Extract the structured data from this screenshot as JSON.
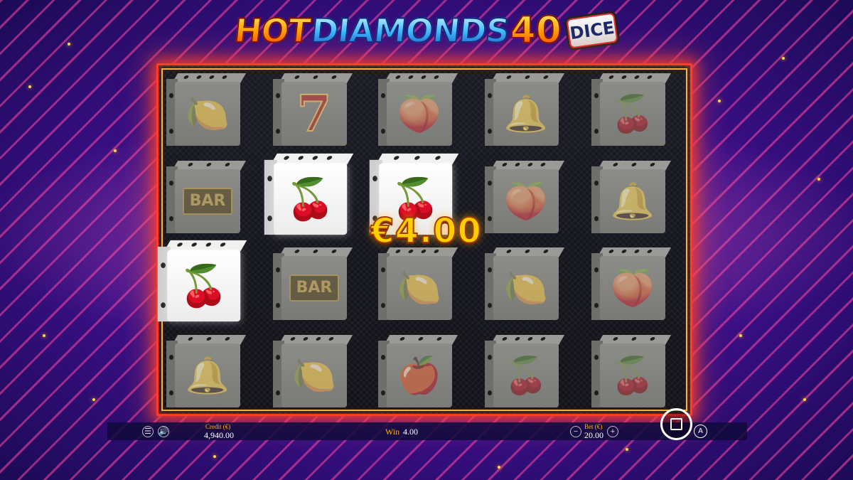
{
  "logo": {
    "hot": "HOT",
    "diamonds": "DIAMONDS",
    "number": "40",
    "badge": "DICE"
  },
  "win_overlay": "€4.00",
  "reels": [
    [
      {
        "symbol": "lemon",
        "glyph": "🍋",
        "lit": false
      },
      {
        "symbol": "bar",
        "glyph": "BAR",
        "lit": false
      },
      {
        "symbol": "cherry",
        "glyph": "🍒",
        "lit": true
      },
      {
        "symbol": "bell",
        "glyph": "🔔",
        "lit": false
      }
    ],
    [
      {
        "symbol": "seven",
        "glyph": "7",
        "lit": false
      },
      {
        "symbol": "cherry",
        "glyph": "🍒",
        "lit": true
      },
      {
        "symbol": "bar",
        "glyph": "BAR",
        "lit": false
      },
      {
        "symbol": "lemon",
        "glyph": "🍋",
        "lit": false
      }
    ],
    [
      {
        "symbol": "plum",
        "glyph": "🍑",
        "lit": false
      },
      {
        "symbol": "cherry",
        "glyph": "🍒",
        "lit": true
      },
      {
        "symbol": "lemon",
        "glyph": "🍋",
        "lit": false
      },
      {
        "symbol": "apple",
        "glyph": "🍎",
        "lit": false
      }
    ],
    [
      {
        "symbol": "bell",
        "glyph": "🔔",
        "lit": false
      },
      {
        "symbol": "plum",
        "glyph": "🍑",
        "lit": false
      },
      {
        "symbol": "lemon",
        "glyph": "🍋",
        "lit": false
      },
      {
        "symbol": "cherry",
        "glyph": "🍒",
        "lit": false
      }
    ],
    [
      {
        "symbol": "cherry",
        "glyph": "🍒",
        "lit": false
      },
      {
        "symbol": "bell",
        "glyph": "🔔",
        "lit": false
      },
      {
        "symbol": "plum",
        "glyph": "🍑",
        "lit": false
      },
      {
        "symbol": "cherry",
        "glyph": "🍒",
        "lit": false
      }
    ]
  ],
  "bottom_bar": {
    "menu_icon": "menu-icon",
    "sound_icon": "speaker-icon",
    "credit_label": "Credit (€)",
    "credit_value": "4,940.00",
    "win_label": "Win",
    "win_value": "4.00",
    "bet_label": "Bet (€)",
    "bet_value": "20.00",
    "bet_decrease": "−",
    "bet_increase": "+",
    "autoplay": "A"
  },
  "colors": {
    "frame": "#ff3b2a",
    "win_text": "#ffd000",
    "credit_label": "#ffb000",
    "win_label": "#ffb000"
  }
}
